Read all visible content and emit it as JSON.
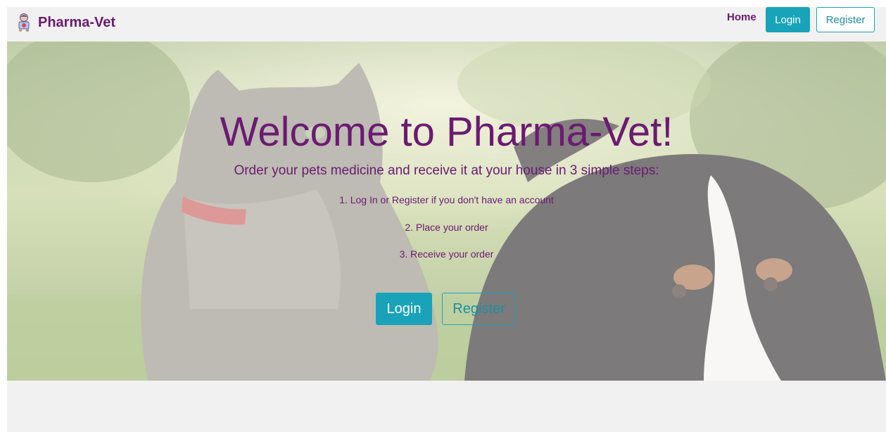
{
  "navbar": {
    "brand_name": "Pharma-Vet",
    "home_label": "Home",
    "login_label": "Login",
    "register_label": "Register"
  },
  "hero": {
    "title": "Welcome to Pharma-Vet!",
    "subtitle": "Order your pets medicine and receive it at your house in 3 simple steps:",
    "steps": [
      "1. Log In or Register if you don't have an account",
      "2. Place your order",
      "3. Receive your order"
    ],
    "login_label": "Login",
    "register_label": "Register"
  },
  "colors": {
    "brand_purple": "#6a1b6e",
    "accent_teal": "#18a3ba",
    "page_background": "#f1f1f1"
  },
  "icons": {
    "brand_logo": "pet-pharmacy-logo-icon"
  }
}
